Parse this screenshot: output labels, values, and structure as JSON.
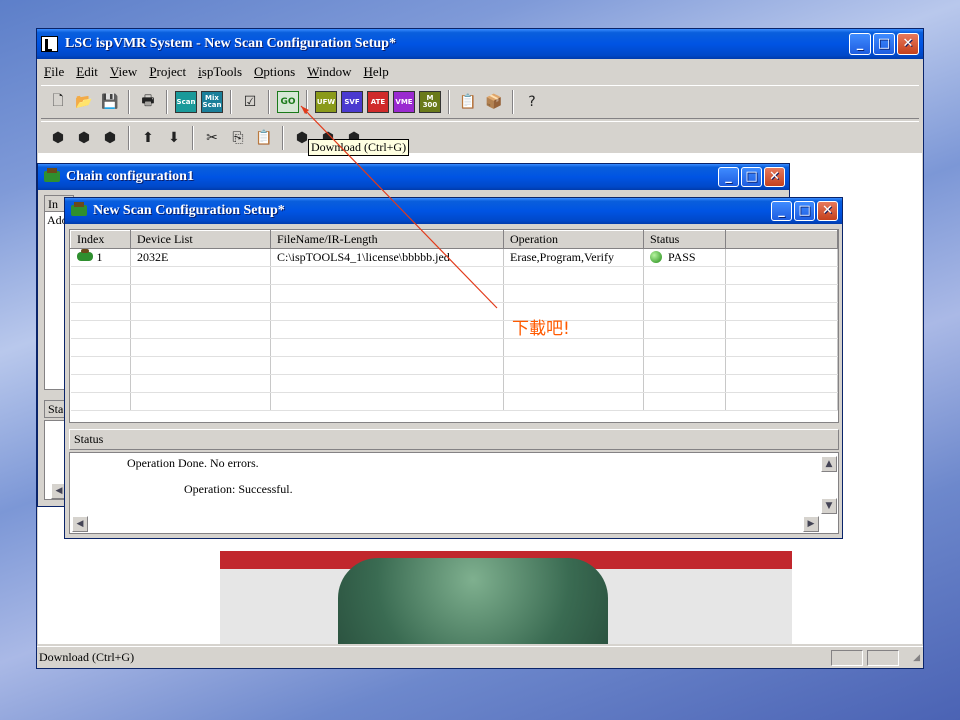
{
  "main_window": {
    "title": "LSC ispVMR System - New Scan Configuration Setup*",
    "menu": [
      "File",
      "Edit",
      "View",
      "Project",
      "ispTools",
      "Options",
      "Window",
      "Help"
    ],
    "toolbar1": {
      "buttons": [
        {
          "icon": "new-file-icon",
          "glyph": "🗋"
        },
        {
          "icon": "open-folder-icon",
          "glyph": "📂"
        },
        {
          "icon": "save-icon",
          "glyph": "💾"
        },
        {
          "icon": "print-icon",
          "glyph": "🖶"
        },
        {
          "icon": "scan-icon",
          "label": "Scan",
          "color": "#1a9a9a"
        },
        {
          "icon": "mix-scan-icon",
          "label": "Mix Scan",
          "color": "#1a7f9a"
        },
        {
          "icon": "check-icon",
          "glyph": "☑"
        },
        {
          "icon": "go-icon",
          "label": "GO",
          "color": "#d6e8d6"
        },
        {
          "icon": "ufw-icon",
          "label": "UFW",
          "color": "#8a9a1a"
        },
        {
          "icon": "svf-icon",
          "label": "SVF",
          "color": "#4a3ad0"
        },
        {
          "icon": "ate-icon",
          "label": "ATE",
          "color": "#d02a2a"
        },
        {
          "icon": "vme-icon",
          "label": "VME",
          "color": "#9a2ad0"
        },
        {
          "icon": "m300-icon",
          "label": "M 300",
          "color": "#6a7a1a"
        },
        {
          "icon": "clipboard-icon",
          "glyph": "📋"
        },
        {
          "icon": "package-icon",
          "glyph": "📦"
        },
        {
          "icon": "help-icon",
          "glyph": "?"
        }
      ]
    },
    "toolbar2": {
      "buttons": [
        {
          "icon": "device-add-icon",
          "glyph": "⬢"
        },
        {
          "icon": "device-insert-icon",
          "glyph": "⬢"
        },
        {
          "icon": "device-edit-icon",
          "glyph": "⬢"
        },
        {
          "icon": "chip-up-icon",
          "glyph": "⬆"
        },
        {
          "icon": "chip-down-icon",
          "glyph": "⬇"
        },
        {
          "icon": "cut-icon",
          "glyph": "✂"
        },
        {
          "icon": "copy-icon",
          "glyph": "⎘"
        },
        {
          "icon": "paste-icon",
          "glyph": "📋"
        },
        {
          "icon": "chain-up-icon",
          "glyph": "⬢"
        },
        {
          "icon": "chain-down-icon",
          "glyph": "⬢"
        },
        {
          "icon": "chain-refresh-icon",
          "glyph": "⬢"
        }
      ]
    },
    "tooltip": "Download (Ctrl+G)",
    "status_text": "Download (Ctrl+G)"
  },
  "chain_window": {
    "title": "Chain configuration1",
    "left_text_1": "In",
    "left_text_2": "Ado",
    "left_text_3": "Sta"
  },
  "scan_window": {
    "title": "New Scan Configuration Setup*",
    "columns": [
      "Index",
      "Device List",
      "FileName/IR-Length",
      "Operation",
      "Status"
    ],
    "rows": [
      {
        "index": "1",
        "device": "2032E",
        "file": "C:\\ispTOOLS4_1\\license\\bbbbb.jed",
        "operation": "Erase,Program,Verify",
        "status": "PASS"
      }
    ],
    "empty_rows": 8,
    "status_label": "Status",
    "status_lines": [
      "Operation Done. No errors.",
      "Operation: Successful."
    ]
  },
  "annotation": "下載吧!",
  "colors": {
    "title_bar": "#0054e3",
    "annotation": "#ff5a00",
    "pass": "#1f8a14"
  }
}
